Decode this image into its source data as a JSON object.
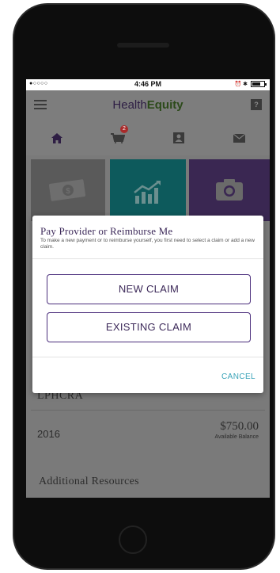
{
  "status_bar": {
    "signal": "●○○○○",
    "time": "4:46 PM",
    "extra_icons": "⏰ ✱"
  },
  "header": {
    "logo_part1": "Health",
    "logo_part2": "Equity",
    "help_label": "?"
  },
  "nav": {
    "items": [
      {
        "icon": "home-icon"
      },
      {
        "icon": "cart-icon",
        "badge": "2"
      },
      {
        "icon": "account-icon"
      },
      {
        "icon": "mail-icon"
      }
    ]
  },
  "modal": {
    "title": "Pay Provider or Reimburse Me",
    "subtitle": "To make a new payment or to reimburse yourself, you first need to select a claim or add a new claim.",
    "new_claim_label": "NEW CLAIM",
    "existing_claim_label": "EXISTING CLAIM",
    "cancel_label": "CANCEL"
  },
  "accounts": {
    "plan_name": "LPHCRA",
    "year": "2016",
    "balance": "$750.00",
    "balance_caption": "Available Balance"
  },
  "resources": {
    "label": "Additional Resources"
  },
  "colors": {
    "brand_purple": "#4b2e7c",
    "cancel_teal": "#3aa3b8",
    "badge_red": "#a82a2a",
    "overlay_gray": "#7a7a7a"
  }
}
